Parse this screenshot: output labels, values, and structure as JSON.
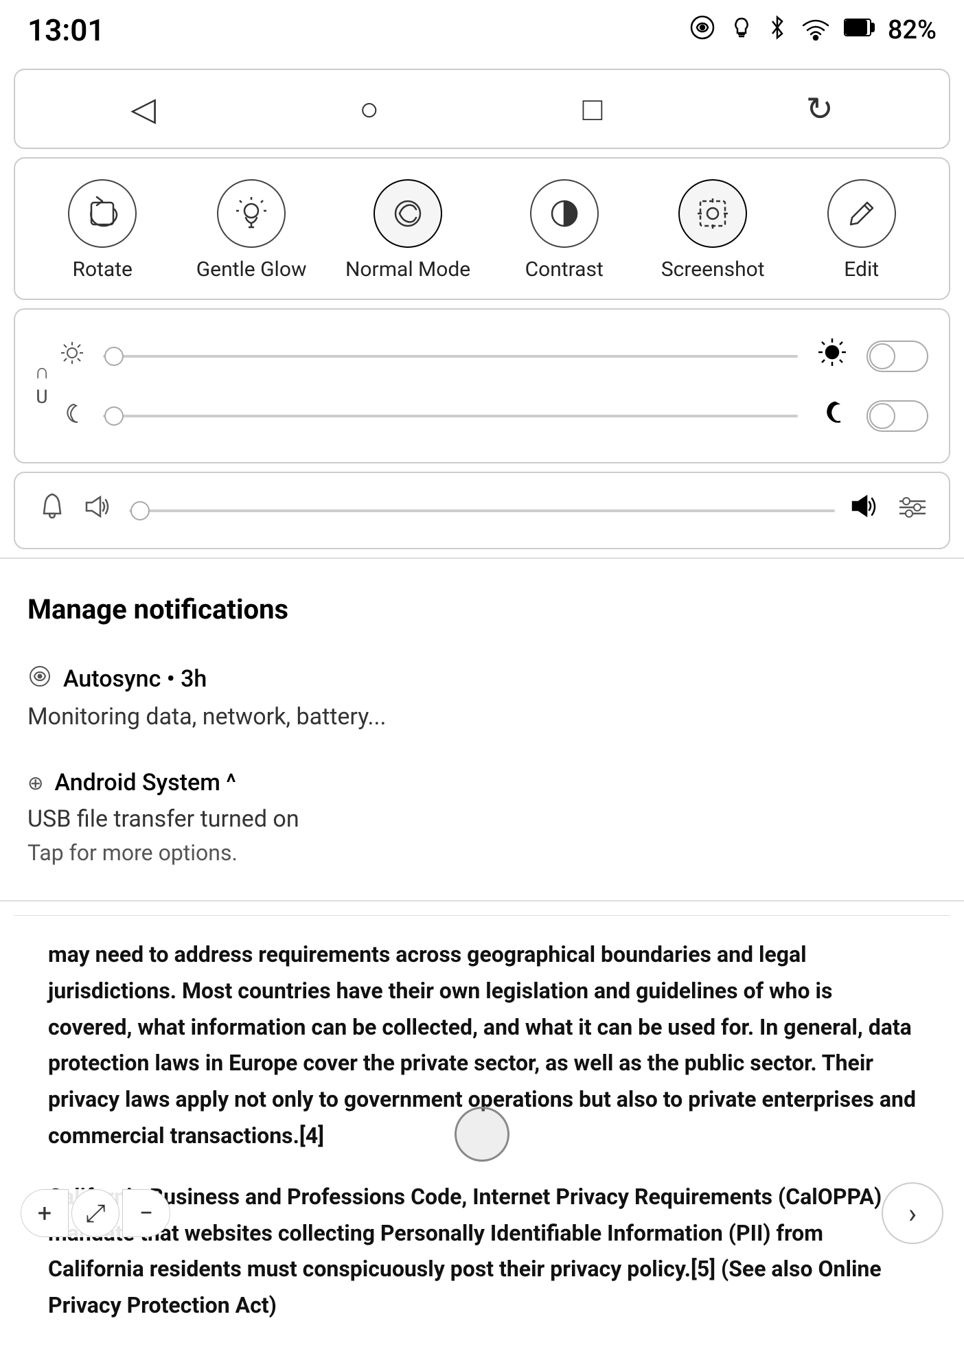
{
  "statusBar": {
    "time": "13:01",
    "battery": "82%",
    "icons": [
      "autosync",
      "lightbulb",
      "bluetooth",
      "wifi",
      "battery"
    ]
  },
  "navBar": {
    "back": "◁",
    "home": "○",
    "recents": "□",
    "refresh": "↻"
  },
  "quickActions": {
    "items": [
      {
        "id": "rotate",
        "label": "Rotate",
        "icon": "⟳"
      },
      {
        "id": "gentle-glow",
        "label": "Gentle Glow",
        "icon": "💡"
      },
      {
        "id": "normal-mode",
        "label": "Normal Mode",
        "icon": "⟳"
      },
      {
        "id": "contrast",
        "label": "Contrast",
        "icon": "◑"
      },
      {
        "id": "screenshot",
        "label": "Screenshot",
        "icon": "⊡"
      },
      {
        "id": "edit",
        "label": "Edit",
        "icon": "✎"
      }
    ]
  },
  "brightnessPanel": {
    "brightnessSliderPosition": 2,
    "darkmodeSliderPosition": 2,
    "toggleOn": false
  },
  "volumePanel": {
    "sliderPosition": 2
  },
  "notifications": {
    "title": "Manage notifications",
    "items": [
      {
        "id": "autosync",
        "icon": "⟳",
        "header": "Autosync • 3h",
        "body": "Monitoring data, network, battery..."
      },
      {
        "id": "android-system",
        "icon": "⊕",
        "header": "Android System ^",
        "body": "USB file transfer turned on",
        "sub": "Tap for more options."
      }
    ]
  },
  "textContent": {
    "paragraph1": "may need to address requirements across geographical boundaries and legal jurisdictions. Most countries have their own legislation and guidelines of who is covered, what information can be collected, and what it can be used for. In general, data protection laws in Europe cover the private sector, as well as the public sector. Their privacy laws apply not only to government operations but also to private enterprises and commercial transactions.[4]",
    "paragraph1_footnote": "4",
    "paragraph2": "California Business and Professions Code, Internet Privacy Requirements (CalOPPA) mandate that websites collecting Personally Identifiable Information (PII) from California residents must conspicuously post their privacy policy.[5] (See also Online Privacy Protection Act)",
    "paragraph2_footnote": "5"
  },
  "bottomControls": {
    "zoomIn": "+",
    "zoomExpand": "⤢",
    "zoomOut": "−",
    "next": "›"
  }
}
